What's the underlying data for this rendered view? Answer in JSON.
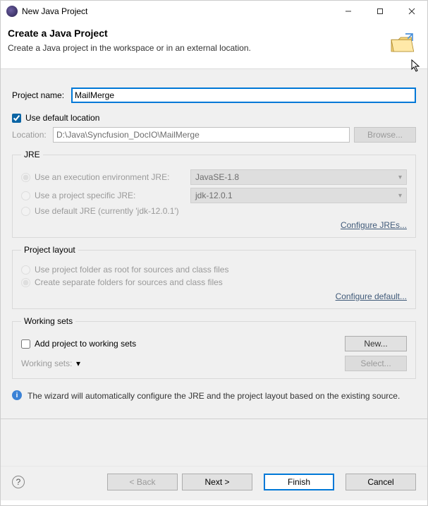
{
  "window": {
    "title": "New Java Project"
  },
  "header": {
    "title": "Create a Java Project",
    "subtitle": "Create a Java project in the workspace or in an external location."
  },
  "project": {
    "name_label": "Project name:",
    "name_value": "MailMerge",
    "use_default_label": "Use default location",
    "use_default_checked": true,
    "location_label": "Location:",
    "location_value": "D:\\Java\\Syncfusion_DocIO\\MailMerge",
    "browse_label": "Browse..."
  },
  "jre": {
    "legend": "JRE",
    "option1_label": "Use an execution environment JRE:",
    "option1_value": "JavaSE-1.8",
    "option2_label": "Use a project specific JRE:",
    "option2_value": "jdk-12.0.1",
    "option3_label": "Use default JRE (currently 'jdk-12.0.1')",
    "configure_label": "Configure JREs..."
  },
  "layout": {
    "legend": "Project layout",
    "option1_label": "Use project folder as root for sources and class files",
    "option2_label": "Create separate folders for sources and class files",
    "configure_label": "Configure default..."
  },
  "workingsets": {
    "legend": "Working sets",
    "add_label": "Add project to working sets",
    "new_label": "New...",
    "ws_label": "Working sets:",
    "select_label": "Select..."
  },
  "info": {
    "message": "The wizard will automatically configure the JRE and the project layout based on the existing source."
  },
  "footer": {
    "back": "< Back",
    "next": "Next >",
    "finish": "Finish",
    "cancel": "Cancel"
  }
}
